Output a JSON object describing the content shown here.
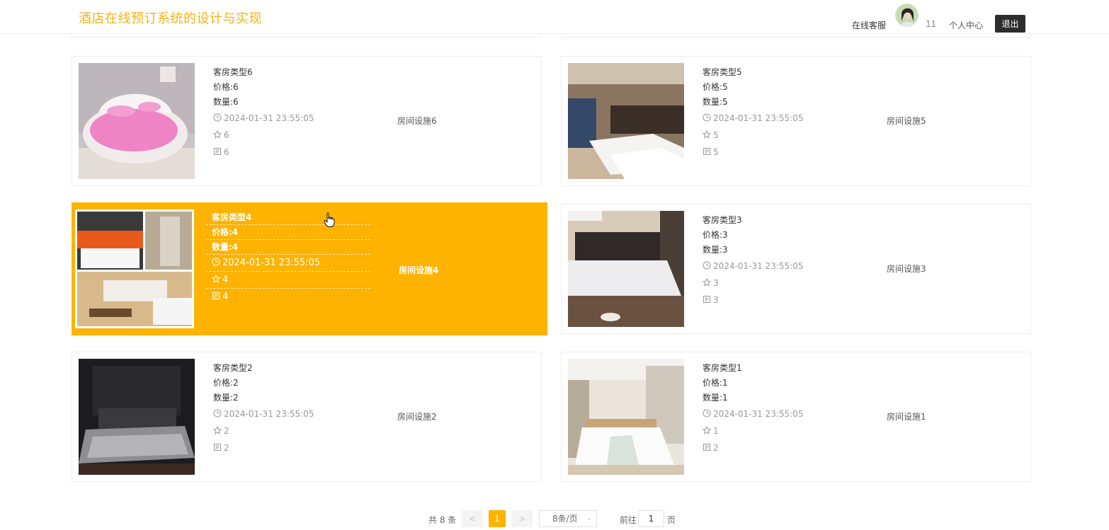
{
  "header": {
    "title": "酒店在线预订系统的设计与实现",
    "customer_service": "在线客服",
    "username": "11",
    "personal_center": "个人中心",
    "logout": "退出"
  },
  "rooms": [
    {
      "type": "客房类型6",
      "price": "价格:6",
      "quantity": "数量:6",
      "time": "2024-01-31 23:55:05",
      "stars": "6",
      "comments": "6",
      "facility": "房间设施6"
    },
    {
      "type": "客房类型5",
      "price": "价格:5",
      "quantity": "数量:5",
      "time": "2024-01-31 23:55:05",
      "stars": "5",
      "comments": "5",
      "facility": "房间设施5"
    },
    {
      "type": "客房类型4",
      "price": "价格:4",
      "quantity": "数量:4",
      "time": "2024-01-31 23:55:05",
      "stars": "4",
      "comments": "4",
      "facility": "房间设施4"
    },
    {
      "type": "客房类型3",
      "price": "价格:3",
      "quantity": "数量:3",
      "time": "2024-01-31 23:55:05",
      "stars": "3",
      "comments": "3",
      "facility": "房间设施3"
    },
    {
      "type": "客房类型2",
      "price": "价格:2",
      "quantity": "数量:2",
      "time": "2024-01-31 23:55:05",
      "stars": "2",
      "comments": "2",
      "facility": "房间设施2"
    },
    {
      "type": "客房类型1",
      "price": "价格:1",
      "quantity": "数量:1",
      "time": "2024-01-31 23:55:05",
      "stars": "1",
      "comments": "2",
      "facility": "房间设施1"
    }
  ],
  "pagination": {
    "total": "共 8 条",
    "prev": "<",
    "current": "1",
    "next": ">",
    "page_size": "8条/页",
    "goto": "前往",
    "goto_value": "1",
    "page_suffix": "页"
  },
  "colors": {
    "accent": "#fdb300",
    "title": "#f5b312",
    "logout_bg": "#2d2d2d"
  }
}
